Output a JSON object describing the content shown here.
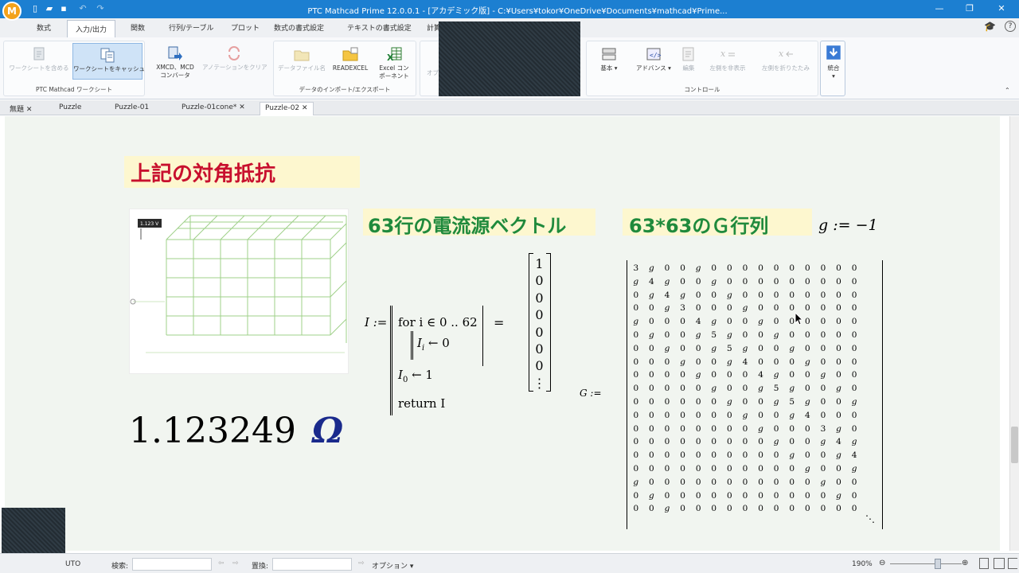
{
  "app": {
    "logo": "M",
    "title": "PTC Mathcad Prime 12.0.0.1 - [アカデミック版] - C:¥Users¥tokor¥OneDrive¥Documents¥mathcad¥Prime..."
  },
  "ribbon_tabs": [
    "数式",
    "入力/出力",
    "関数",
    "行列/テーブル",
    "プロット",
    "数式の書式設定",
    "テキストの書式設定",
    "計算"
  ],
  "ribbon": {
    "group1_label": "PTC Mathcad ワークシート",
    "btn_include": "ワークシートを含める",
    "btn_cache": "ワークシートをキャッシュ",
    "btn_xmcd_1": "XMCD、MCD",
    "btn_xmcd_2": "コンバータ",
    "btn_clear": "アノテーションをクリア",
    "group2_label": "データのインポート/エクスポート",
    "btn_datafile": "データファイル名",
    "btn_readexcel": "READEXCEL",
    "btn_excel_1": "Excel コン",
    "btn_excel_2": "ポーネント",
    "btn_other": "オブ",
    "group3_label": "コントロール",
    "btn_basic": "基本",
    "btn_advanced": "アドバンス",
    "btn_edit": "編集",
    "btn_hide_left": "左側を非表示",
    "btn_collapse_left": "左側を折りたたみ",
    "btn_merge": "統合"
  },
  "doc_tabs": [
    {
      "label": "無題",
      "closable": true
    },
    {
      "label": "Puzzle",
      "closable": false
    },
    {
      "label": "Puzzle-01",
      "closable": false
    },
    {
      "label": "Puzzle-01cone*",
      "closable": true
    },
    {
      "label": "Puzzle-02",
      "closable": true
    }
  ],
  "worksheet": {
    "heading_red": "上記の対角抵抗",
    "heading_vector": "63行の電流源ベクトル",
    "heading_matrix": "63*63のＧ行列",
    "g_def": "g := −1",
    "image_tooltip": "1.123 V",
    "result_value": "1.123249",
    "result_unit": "Ω",
    "program": {
      "lhs": "I :=",
      "line1": "for i ∈ 0 .. 62",
      "line2_var": "I",
      "line2_sub": "i",
      "line2_rest": "← 0",
      "line3_var": "I",
      "line3_sub": "0",
      "line3_rest": "← 1",
      "line4": "return I",
      "equals": "="
    },
    "vector_result": [
      "1",
      "0",
      "0",
      "0",
      "0",
      "0",
      "0",
      "⋮"
    ],
    "matrix_lhs": "G :=",
    "matrix_rows": [
      [
        "3",
        "g",
        "0",
        "0",
        "g",
        "0",
        "0",
        "0",
        "0",
        "0",
        "0",
        "0",
        "0",
        "0",
        "0"
      ],
      [
        "g",
        "4",
        "g",
        "0",
        "0",
        "g",
        "0",
        "0",
        "0",
        "0",
        "0",
        "0",
        "0",
        "0",
        "0"
      ],
      [
        "0",
        "g",
        "4",
        "g",
        "0",
        "0",
        "g",
        "0",
        "0",
        "0",
        "0",
        "0",
        "0",
        "0",
        "0"
      ],
      [
        "0",
        "0",
        "g",
        "3",
        "0",
        "0",
        "0",
        "g",
        "0",
        "0",
        "0",
        "0",
        "0",
        "0",
        "0"
      ],
      [
        "g",
        "0",
        "0",
        "0",
        "4",
        "g",
        "0",
        "0",
        "g",
        "0",
        "0",
        "0",
        "0",
        "0",
        "0"
      ],
      [
        "0",
        "g",
        "0",
        "0",
        "g",
        "5",
        "g",
        "0",
        "0",
        "g",
        "0",
        "0",
        "0",
        "0",
        "0"
      ],
      [
        "0",
        "0",
        "g",
        "0",
        "0",
        "g",
        "5",
        "g",
        "0",
        "0",
        "g",
        "0",
        "0",
        "0",
        "0"
      ],
      [
        "0",
        "0",
        "0",
        "g",
        "0",
        "0",
        "g",
        "4",
        "0",
        "0",
        "0",
        "g",
        "0",
        "0",
        "0"
      ],
      [
        "0",
        "0",
        "0",
        "0",
        "g",
        "0",
        "0",
        "0",
        "4",
        "g",
        "0",
        "0",
        "g",
        "0",
        "0"
      ],
      [
        "0",
        "0",
        "0",
        "0",
        "0",
        "g",
        "0",
        "0",
        "g",
        "5",
        "g",
        "0",
        "0",
        "g",
        "0"
      ],
      [
        "0",
        "0",
        "0",
        "0",
        "0",
        "0",
        "g",
        "0",
        "0",
        "g",
        "5",
        "g",
        "0",
        "0",
        "g"
      ],
      [
        "0",
        "0",
        "0",
        "0",
        "0",
        "0",
        "0",
        "g",
        "0",
        "0",
        "g",
        "4",
        "0",
        "0",
        "0"
      ],
      [
        "0",
        "0",
        "0",
        "0",
        "0",
        "0",
        "0",
        "0",
        "g",
        "0",
        "0",
        "0",
        "3",
        "g",
        "0"
      ],
      [
        "0",
        "0",
        "0",
        "0",
        "0",
        "0",
        "0",
        "0",
        "0",
        "g",
        "0",
        "0",
        "g",
        "4",
        "g"
      ],
      [
        "0",
        "0",
        "0",
        "0",
        "0",
        "0",
        "0",
        "0",
        "0",
        "0",
        "g",
        "0",
        "0",
        "g",
        "4"
      ],
      [
        "0",
        "0",
        "0",
        "0",
        "0",
        "0",
        "0",
        "0",
        "0",
        "0",
        "0",
        "g",
        "0",
        "0",
        "g"
      ],
      [
        "g",
        "0",
        "0",
        "0",
        "0",
        "0",
        "0",
        "0",
        "0",
        "0",
        "0",
        "0",
        "g",
        "0",
        "0"
      ],
      [
        "0",
        "g",
        "0",
        "0",
        "0",
        "0",
        "0",
        "0",
        "0",
        "0",
        "0",
        "0",
        "0",
        "g",
        "0"
      ],
      [
        "0",
        "0",
        "g",
        "0",
        "0",
        "0",
        "0",
        "0",
        "0",
        "0",
        "0",
        "0",
        "0",
        "0",
        "0"
      ]
    ],
    "matrix_ellipsis": "⋱"
  },
  "statusbar": {
    "auto_label": "UTO",
    "search_label": "検索:",
    "replace_label": "置換:",
    "options_label": "オプション",
    "zoom": "190%"
  },
  "colors": {
    "titlebar": "#1c7fd1",
    "heading_red": "#c8102e",
    "heading_green": "#1f8a3c",
    "omega_blue": "#1a2a8c"
  }
}
